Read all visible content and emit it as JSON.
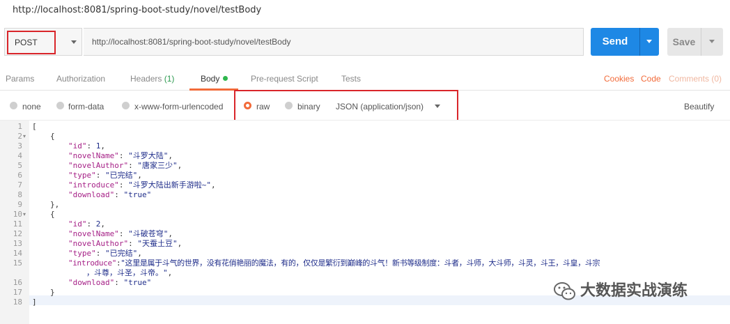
{
  "window": {
    "title": "http://localhost:8081/spring-boot-study/novel/testBody"
  },
  "request": {
    "method": "POST",
    "url": "http://localhost:8081/spring-boot-study/novel/testBody",
    "send_label": "Send",
    "save_label": "Save"
  },
  "tabs": {
    "params": "Params",
    "authorization": "Authorization",
    "headers": "Headers",
    "headers_count": "(1)",
    "body": "Body",
    "prerequest": "Pre-request Script",
    "tests": "Tests",
    "cookies": "Cookies",
    "code": "Code",
    "comments": "Comments (0)"
  },
  "body_options": {
    "none": "none",
    "form_data": "form-data",
    "urlencoded": "x-www-form-urlencoded",
    "raw": "raw",
    "binary": "binary",
    "content_type": "JSON (application/json)",
    "beautify": "Beautify",
    "selected": "raw"
  },
  "editor": {
    "line_numbers": [
      "1",
      "2",
      "3",
      "4",
      "5",
      "6",
      "7",
      "8",
      "9",
      "10",
      "11",
      "12",
      "13",
      "14",
      "15",
      "",
      "16",
      "17",
      "18"
    ],
    "l1": "[",
    "l2": "{",
    "novel1": {
      "id_key": "\"id\"",
      "id_val": "1",
      "name_key": "\"novelName\"",
      "name_val": "\"斗罗大陆\"",
      "author_key": "\"novelAuthor\"",
      "author_val": "\"唐家三少\"",
      "type_key": "\"type\"",
      "type_val": "\"已完结\"",
      "intro_key": "\"introduce\"",
      "intro_val": "\"斗罗大陆出新手游啦~\"",
      "download_key": "\"download\"",
      "download_val": "\"true\""
    },
    "l9": "},",
    "l10": "{",
    "novel2": {
      "id_key": "\"id\"",
      "id_val": "2",
      "name_key": "\"novelName\"",
      "name_val": "\"斗破苍穹\"",
      "author_key": "\"novelAuthor\"",
      "author_val": "\"天蚕土豆\"",
      "type_key": "\"type\"",
      "type_val": "\"已完结\"",
      "intro_key": "\"introduce\"",
      "intro_val_a": "\"这里是属于斗气的世界，没有花俏艳丽的魔法，有的，仅仅是繁衍到巅峰的斗气！新书等级制度：斗者，斗师，大斗师，斗灵，斗王，斗皇，斗宗",
      "intro_val_b": "，斗尊，斗圣，斗帝。\"",
      "download_key": "\"download\"",
      "download_val": "\"true\""
    },
    "l17": "}",
    "l18": "]"
  },
  "watermark": {
    "text": "大数据实战演练"
  }
}
